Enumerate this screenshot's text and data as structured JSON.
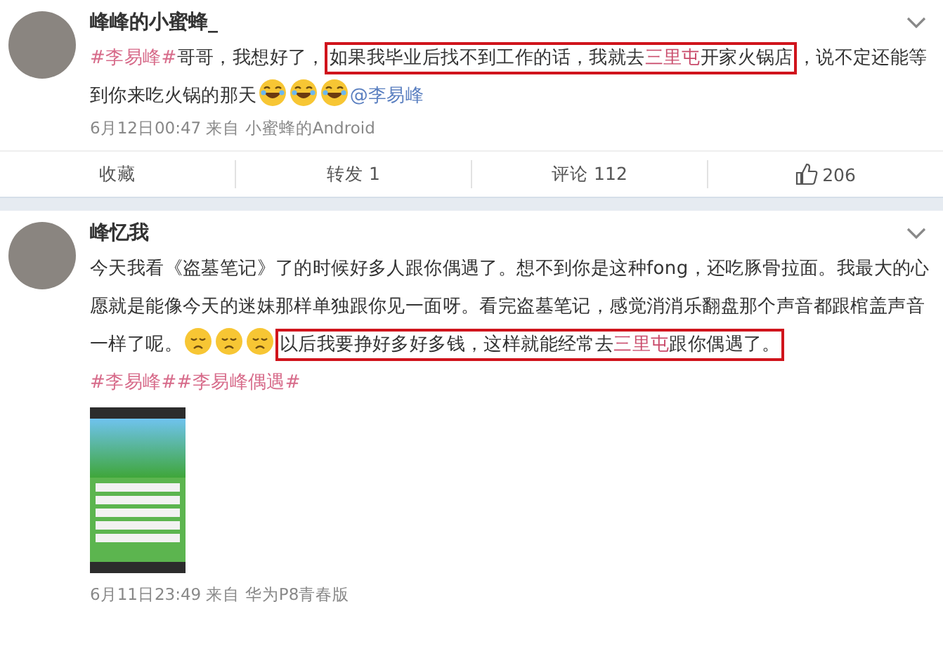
{
  "posts": [
    {
      "author": "峰峰的小蜜蜂_",
      "body": [
        {
          "kind": "topic",
          "text": "#李易峰#"
        },
        {
          "kind": "text",
          "text": "哥哥，我想好了，"
        },
        {
          "kind": "box",
          "parts": [
            {
              "kind": "text",
              "text": "如果我毕业后找不到工作的话，我就去"
            },
            {
              "kind": "place",
              "text": "三里屯"
            },
            {
              "kind": "text",
              "text": "开家火锅店"
            }
          ]
        },
        {
          "kind": "text",
          "text": "，说不定还能等到你来吃火锅的那天"
        },
        {
          "kind": "laugh"
        },
        {
          "kind": "laugh"
        },
        {
          "kind": "laugh"
        },
        {
          "kind": "mention",
          "text": "@李易峰"
        }
      ],
      "time": "6月12日00:47",
      "source_label": "来自",
      "source": "小蜜蜂的Android",
      "actions": [
        {
          "kind": "text",
          "label": "收藏"
        },
        {
          "kind": "text",
          "label": "转发 1"
        },
        {
          "kind": "text",
          "label": "评论 112"
        },
        {
          "kind": "like",
          "label": "206"
        }
      ]
    },
    {
      "author": "峰忆我",
      "body": [
        {
          "kind": "text",
          "text": "今天我看《盗墓笔记》了的时候好多人跟你偶遇了。想不到你是这种fong，还吃豚骨拉面。我最大的心愿就是能像今天的迷妹那样单独跟你见一面呀。看完盗墓笔记，感觉消消乐翻盘那个声音都跟棺盖声音一样了呢。"
        },
        {
          "kind": "sad"
        },
        {
          "kind": "sad"
        },
        {
          "kind": "sad"
        },
        {
          "kind": "box",
          "parts": [
            {
              "kind": "text",
              "text": "以后我要挣好多好多钱，这样就能经常去"
            },
            {
              "kind": "place",
              "text": "三里屯"
            },
            {
              "kind": "text",
              "text": "跟你偶遇了。"
            }
          ]
        },
        {
          "kind": "topic",
          "text": "#李易峰#"
        },
        {
          "kind": "topic",
          "text": "#李易峰偶遇#"
        }
      ],
      "image": true,
      "time": "6月11日23:49",
      "source_label": "来自",
      "source": "华为P8青春版"
    }
  ]
}
